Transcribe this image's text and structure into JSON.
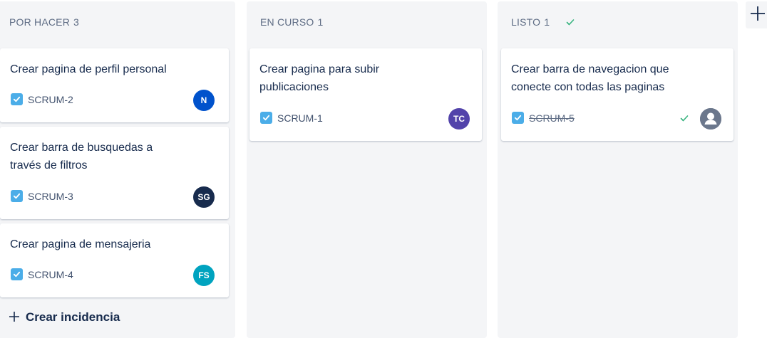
{
  "columns": [
    {
      "title": "POR HACER",
      "count": "3",
      "cards": [
        {
          "title": "Crear pagina de perfil personal",
          "key": "SCRUM-2",
          "avatar": "N",
          "avatar_color": "#0052cc"
        },
        {
          "title": "Crear barra de busquedas a través de filtros",
          "key": "SCRUM-3",
          "avatar": "SG",
          "avatar_color": "#172b4d"
        },
        {
          "title": "Crear pagina de mensajeria",
          "key": "SCRUM-4",
          "avatar": "FS",
          "avatar_color": "#00a3bf"
        }
      ],
      "create_label": "Crear incidencia"
    },
    {
      "title": "EN CURSO",
      "count": "1",
      "cards": [
        {
          "title": "Crear pagina para subir publicaciones",
          "key": "SCRUM-1",
          "avatar": "TC",
          "avatar_color": "#5243aa"
        }
      ]
    },
    {
      "title": "LISTO",
      "count": "1",
      "cards": [
        {
          "title": "Crear barra de navegacion que conecte con todas las paginas",
          "key": "SCRUM-5",
          "avatar": "user-icon",
          "avatar_color": "#6b778c"
        }
      ]
    }
  ],
  "colors": {
    "column_bg": "#f4f5f7",
    "checkbox": "#4bade8",
    "done_green": "#36b37e"
  },
  "icons": {
    "add_column": "plus-icon",
    "done": "check-icon"
  }
}
